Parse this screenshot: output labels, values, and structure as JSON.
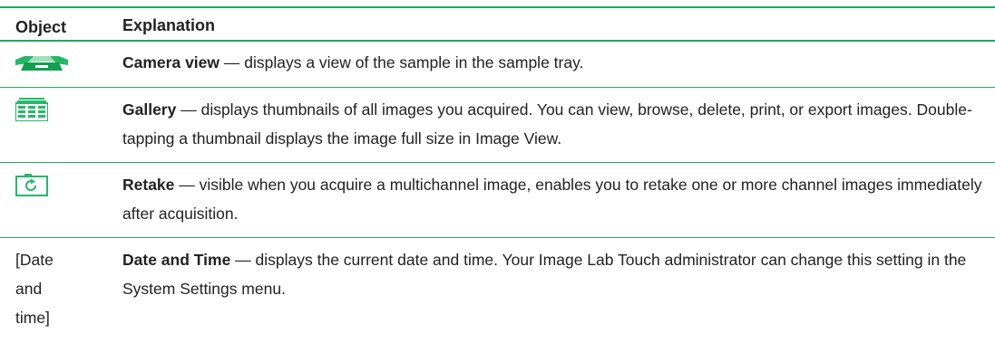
{
  "header": {
    "object": "Object",
    "explanation": "Explanation"
  },
  "rows": [
    {
      "icon": "camera-view-icon",
      "term": "Camera view",
      "text": " — displays a view of the sample in the sample tray."
    },
    {
      "icon": "gallery-icon",
      "term": "Gallery",
      "text": " — displays thumbnails of all images you acquired. You can view, browse, delete, print, or export images. Double-tapping a thumbnail displays the image full size in Image View."
    },
    {
      "icon": "retake-icon",
      "term": "Retake",
      "text": " — visible when you acquire a multichannel image, enables you to retake one or more channel images immediately after acquisition."
    },
    {
      "object_text": [
        "[Date",
        "and",
        "time]"
      ],
      "term": "Date and Time",
      "text": " — displays the current date and time. Your Image Lab Touch administrator can change this setting in the System Settings menu."
    }
  ],
  "colors": {
    "accent": "#1aab5a",
    "text": "#222222"
  }
}
